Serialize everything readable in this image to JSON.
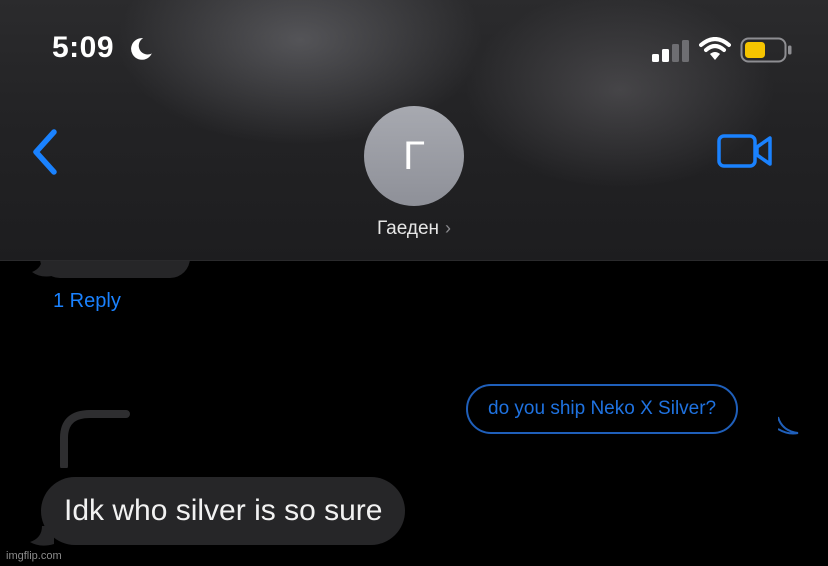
{
  "status_bar": {
    "time": "5:09",
    "icons": [
      "moon-icon",
      "cellular-signal-icon",
      "wifi-icon",
      "battery-icon"
    ],
    "battery_color": "#f5c400"
  },
  "header": {
    "back_icon": "chevron-left-icon",
    "avatar_initial": "Г",
    "contact_name": "Гаеден",
    "contact_chevron": "›",
    "video_icon": "video-camera-icon",
    "accent_color": "#1a82ff"
  },
  "thread": {
    "reply_link": "1 Reply",
    "messages": [
      {
        "direction": "sent",
        "text": "do you ship Neko X Silver?",
        "style": "outlined"
      },
      {
        "direction": "received",
        "text": "Idk who silver is so sure"
      }
    ]
  },
  "watermark": "imgflip.com"
}
